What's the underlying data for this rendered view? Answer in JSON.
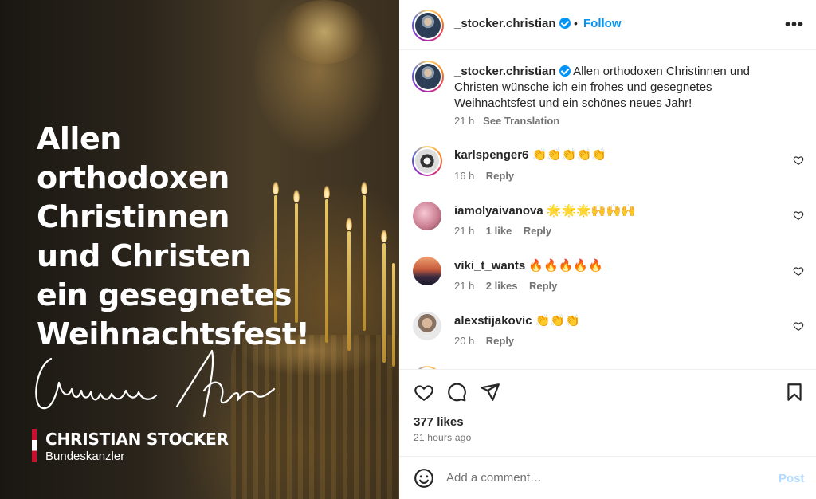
{
  "media": {
    "headline_lines": [
      "Allen",
      "orthodoxen",
      "Christinnen",
      "und Christen",
      "ein gesegnetes",
      "Weihnachtsfest!"
    ],
    "brand_name": "CHRISTIAN STOCKER",
    "brand_role": "Bundeskanzler",
    "signature_text": "Christian Stocker"
  },
  "header": {
    "username": "_stocker.christian",
    "separator": "•",
    "follow_label": "Follow",
    "more_label": "•••"
  },
  "caption": {
    "username": "_stocker.christian",
    "text": "Allen orthodoxen Christinnen und Christen wünsche ich ein frohes und gesegnetes Weihnachtsfest und ein schönes neues Jahr!",
    "time": "21 h",
    "translation_label": "See Translation"
  },
  "comments": [
    {
      "username": "karlspenger6",
      "text": "👏👏👏👏👏",
      "time": "16 h",
      "likes": "",
      "reply_label": "Reply"
    },
    {
      "username": "iamolyaivanova",
      "text": "🌟🌟🌟🙌🙌🙌",
      "time": "21 h",
      "likes": "1 like",
      "reply_label": "Reply"
    },
    {
      "username": "viki_t_wants",
      "text": "🔥🔥🔥🔥🔥",
      "time": "21 h",
      "likes": "2 likes",
      "reply_label": "Reply"
    },
    {
      "username": "alexstijakovic",
      "text": "👏👏👏",
      "time": "20 h",
      "likes": "",
      "reply_label": "Reply"
    }
  ],
  "footer": {
    "likes": "377 likes",
    "time_ago": "21 hours ago",
    "comment_placeholder": "Add a comment…",
    "post_label": "Post"
  },
  "colors": {
    "accent": "#0095f6",
    "post_disabled": "#b3dbff",
    "muted": "#737373",
    "brand_red": "#c8102e"
  },
  "icons": [
    "heart-icon",
    "comment-icon",
    "share-icon",
    "bookmark-icon",
    "emoji-icon",
    "more-icon",
    "verified-badge-icon"
  ]
}
